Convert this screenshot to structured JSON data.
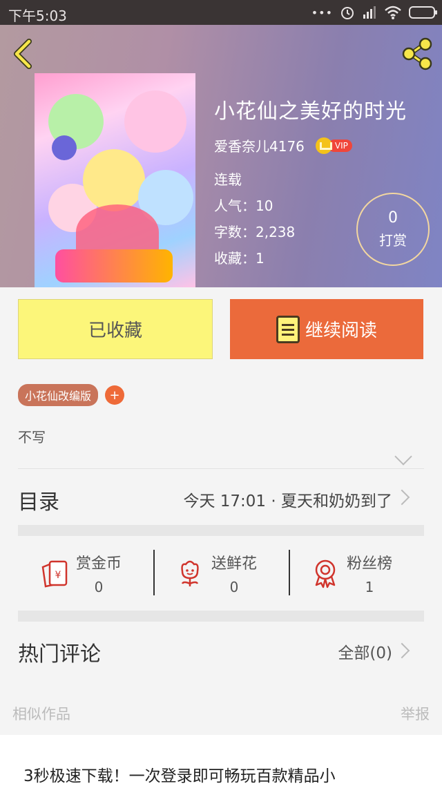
{
  "status_bar": {
    "time": "下午5:03",
    "dots": "•••"
  },
  "book": {
    "title": "小花仙之美好的时光",
    "author": "爱香奈儿4176",
    "vip_badge": "VIP",
    "status": "连载",
    "popularity": "人气：10",
    "word_count": "字数：2,238",
    "favorites": "收藏：1",
    "tip_count": "0",
    "tip_label": "打赏"
  },
  "actions": {
    "collected_label": "已收藏",
    "continue_read_label": "继续阅读"
  },
  "tag": {
    "label": "小花仙改编版",
    "add_symbol": "+"
  },
  "description": "不写",
  "catalog": {
    "label": "目录",
    "latest": "今天 17:01 · 夏天和奶奶到了"
  },
  "rewards": [
    {
      "label": "赏金币",
      "value": "0",
      "icon": "red-envelope-icon"
    },
    {
      "label": "送鲜花",
      "value": "0",
      "icon": "flower-icon"
    },
    {
      "label": "粉丝榜",
      "value": "1",
      "icon": "medal-icon"
    }
  ],
  "comments": {
    "label": "热门评论",
    "all_label": "全部(0)"
  },
  "footer": {
    "similar_label": "相似作品",
    "report_label": "举报"
  },
  "ad": {
    "text": "3秒极速下载！一次登录即可畅玩百款精品小"
  },
  "colors": {
    "accent_orange": "#eb6a3b",
    "collected_yellow": "#fcf67a",
    "icon_red": "#d0342c",
    "back_yellow": "#f7e64a"
  }
}
